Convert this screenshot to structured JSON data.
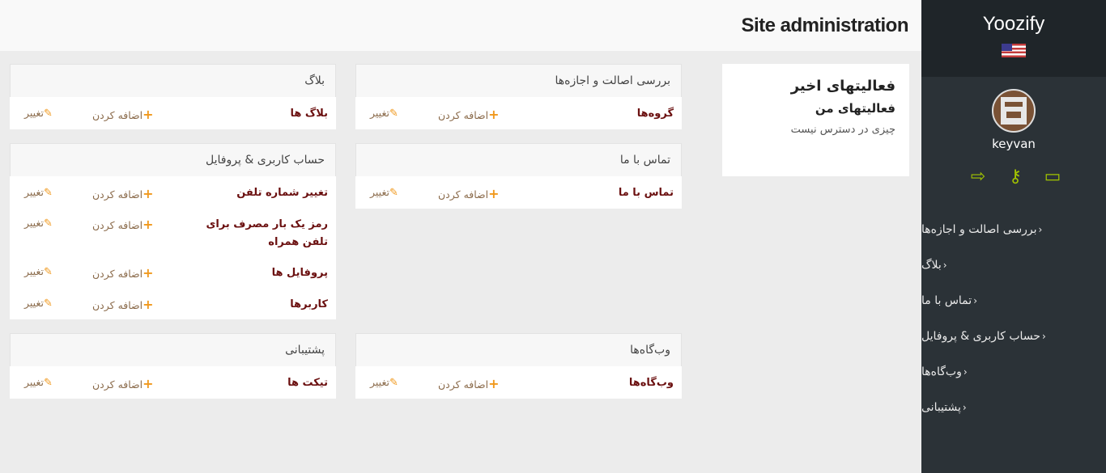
{
  "sidebar": {
    "brand": "Yoozify",
    "username": "keyvan",
    "user_icons": [
      "logout-icon",
      "key-icon",
      "monitor-icon"
    ],
    "nav": [
      {
        "label": "بررسی اصالت و اجازه‌ها"
      },
      {
        "label": "بلاگ"
      },
      {
        "label": "تماس با ما"
      },
      {
        "label": "حساب کاربری & پروفایل"
      },
      {
        "label": "وب‌گاه‌ها"
      },
      {
        "label": "پشتیبانی"
      }
    ]
  },
  "header": {
    "title": "Site administration"
  },
  "recent": {
    "title": "فعالیتهای اخیر",
    "subtitle": "فعالیتهای من",
    "empty": "چیزی در دسترس نیست"
  },
  "links": {
    "add": "اضافه کردن",
    "change": "تغییر"
  },
  "modules": {
    "auth": {
      "title": "بررسی اصالت و اجازه‌ها",
      "models": [
        "گروه‌ها"
      ]
    },
    "blog": {
      "title": "بلاگ",
      "models": [
        "بلاگ ها"
      ]
    },
    "contact": {
      "title": "تماس با ما",
      "models": [
        "تماس با ما"
      ]
    },
    "account": {
      "title": "حساب کاربری & پروفایل",
      "models": [
        "تغییر شماره تلفن",
        "رمز یک بار مصرف برای تلفن همراه",
        "پروفایل ها",
        "کاربرها"
      ]
    },
    "sites": {
      "title": "وب‌گاه‌ها",
      "models": [
        "وب‌گاه‌ها"
      ]
    },
    "support": {
      "title": "پشتیبانی",
      "models": [
        "تیکت ها"
      ]
    }
  },
  "colors": {
    "accent": "#a2c400",
    "model_link": "#6b1010",
    "action_icon": "#f0981c",
    "sidebar_bg": "#2b3237"
  }
}
